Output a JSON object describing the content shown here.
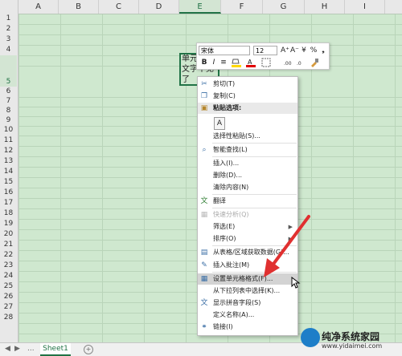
{
  "columns": [
    "A",
    "B",
    "C",
    "D",
    "E",
    "F",
    "G",
    "H",
    "I"
  ],
  "rows": [
    "1",
    "2",
    "3",
    "4",
    "5",
    "6",
    "7",
    "8",
    "9",
    "10",
    "11",
    "12",
    "13",
    "14",
    "15",
    "16",
    "17",
    "18",
    "19",
    "20",
    "21",
    "22",
    "23",
    "24",
    "25",
    "26",
    "27",
    "28"
  ],
  "active_cell": {
    "column": "E",
    "row": "5",
    "text": "单元格\n文字不见\n了"
  },
  "mini_toolbar": {
    "font_name": "宋体",
    "font_size": "12",
    "grow_font": "A⁺",
    "shrink_font": "A⁻",
    "currency": "¥",
    "percent": "%",
    "comma": "❟",
    "bold": "B",
    "italic": "I",
    "align": "≡",
    "fill_color": "#ffd800",
    "font_color": "#e00000"
  },
  "context_menu": {
    "cut": "剪切(T)",
    "copy": "复制(C)",
    "paste_options": "粘贴选项:",
    "paste_special": "选择性粘贴(S)...",
    "smart_lookup": "智能查找(L)",
    "insert": "插入(I)...",
    "delete": "删除(D)...",
    "clear_contents": "清除内容(N)",
    "translate": "翻译",
    "quick_analysis": "快速分析(Q)",
    "filter": "筛选(E)",
    "sort": "排序(O)",
    "get_data": "从表格/区域获取数据(G)...",
    "insert_comment": "插入批注(M)",
    "format_cells": "设置单元格格式(F)...",
    "pick_from_list": "从下拉列表中选择(K)...",
    "phonetic": "显示拼音字段(S)",
    "define_name": "定义名称(A)...",
    "link": "链接(I)"
  },
  "sheet_tabs": {
    "nav_dots": "...",
    "active": "Sheet1"
  },
  "watermark": {
    "title": "纯净系统家园",
    "url": "www.yidaimei.com"
  },
  "colors": {
    "grid_bg": "#cfe8cf",
    "accent": "#217346",
    "arrow": "#e03030"
  }
}
